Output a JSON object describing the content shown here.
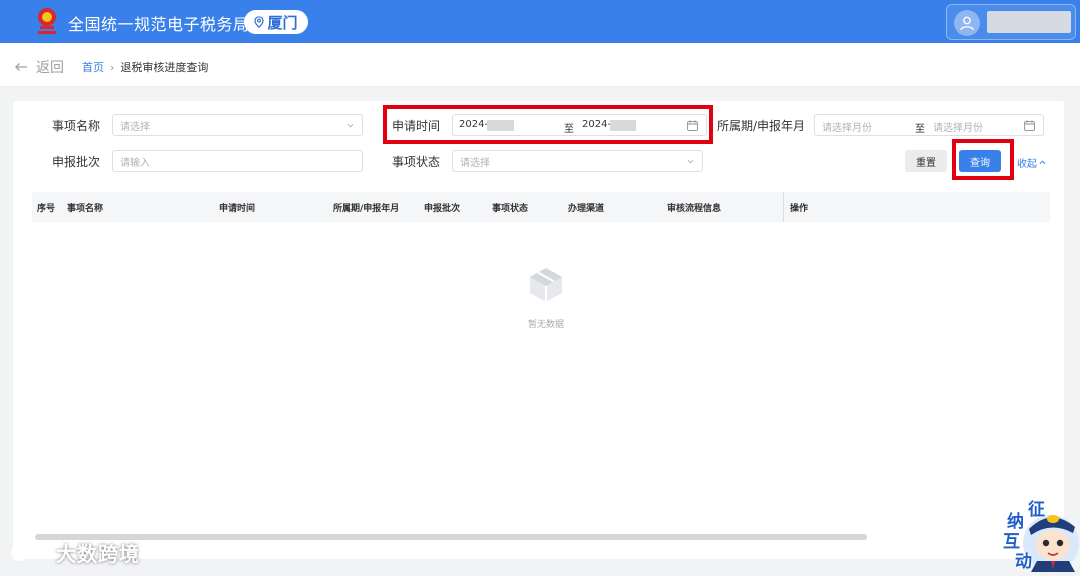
{
  "header": {
    "app_title": "全国统一规范电子税务局",
    "city": "厦门",
    "username": ""
  },
  "breadcrumb": {
    "back_label": "返回",
    "home": "首页",
    "separator": "›",
    "current": "退税审核进度查询"
  },
  "filters": {
    "item_name": {
      "label": "事项名称",
      "placeholder": "请选择"
    },
    "apply_time": {
      "label": "申请时间",
      "start_value": "2024-",
      "separator": "至",
      "end_value": "2024-"
    },
    "period": {
      "label": "所属期/申报年月",
      "start_placeholder": "请选择月份",
      "separator": "至",
      "end_placeholder": "请选择月份"
    },
    "batch": {
      "label": "申报批次",
      "placeholder": "请输入"
    },
    "status": {
      "label": "事项状态",
      "placeholder": "请选择"
    },
    "reset_label": "重置",
    "query_label": "查询",
    "collapse_label": "收起"
  },
  "table": {
    "columns": [
      "序号",
      "事项名称",
      "申请时间",
      "所属期/申报年月",
      "申报批次",
      "事项状态",
      "办理渠道",
      "审核流程信息",
      "操作"
    ],
    "rows": [],
    "empty_text": "暂无数据"
  },
  "watermark": {
    "text": "大数跨境"
  },
  "mascot": {
    "chars": [
      "征",
      "纳",
      "互",
      "动"
    ]
  },
  "colors": {
    "brand_blue": "#3a80ea",
    "highlight_red": "#e0000f"
  }
}
